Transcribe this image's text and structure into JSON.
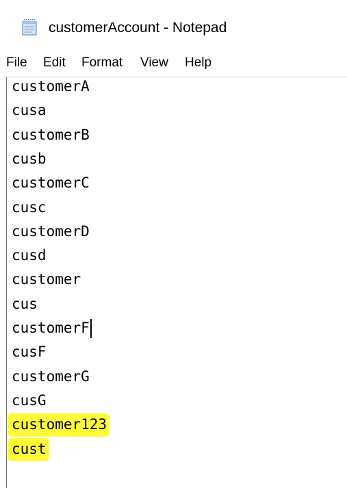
{
  "window": {
    "title": "customerAccount - Notepad",
    "icon": "notepad-icon"
  },
  "menu": [
    "File",
    "Edit",
    "Format",
    "View",
    "Help"
  ],
  "editor": {
    "lines": [
      "customerA",
      "cusa",
      "customerB",
      "cusb",
      "customerC",
      "cusc",
      "customerD",
      "cusd",
      "customer",
      "cus",
      "customerF",
      "cusF",
      "customerG",
      "cusG",
      "customer123",
      "cust"
    ],
    "highlighted_lines": [
      "customer123",
      "cust"
    ],
    "highlight_color": "#fffb3a",
    "caret_line": "customerF"
  }
}
